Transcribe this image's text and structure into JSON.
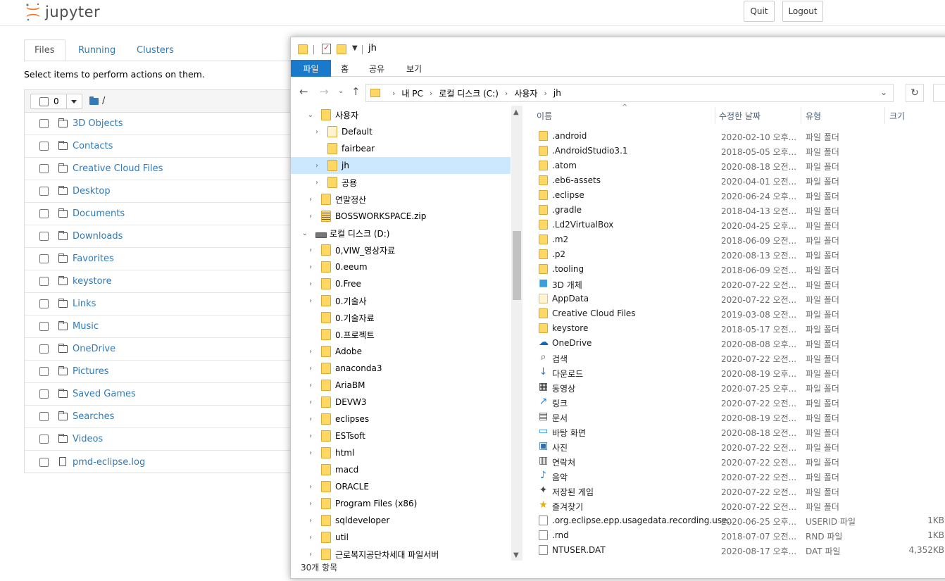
{
  "jupyter": {
    "brand": "jupyter",
    "quit_label": "Quit",
    "logout_label": "Logout",
    "tabs": [
      "Files",
      "Running",
      "Clusters"
    ],
    "hint": "Select items to perform actions on them.",
    "selected_count": "0",
    "path": "/",
    "items": [
      {
        "name": "3D Objects",
        "kind": "folder"
      },
      {
        "name": "Contacts",
        "kind": "folder"
      },
      {
        "name": "Creative Cloud Files",
        "kind": "folder"
      },
      {
        "name": "Desktop",
        "kind": "folder"
      },
      {
        "name": "Documents",
        "kind": "folder"
      },
      {
        "name": "Downloads",
        "kind": "folder"
      },
      {
        "name": "Favorites",
        "kind": "folder"
      },
      {
        "name": "keystore",
        "kind": "folder"
      },
      {
        "name": "Links",
        "kind": "folder"
      },
      {
        "name": "Music",
        "kind": "folder"
      },
      {
        "name": "OneDrive",
        "kind": "folder"
      },
      {
        "name": "Pictures",
        "kind": "folder"
      },
      {
        "name": "Saved Games",
        "kind": "folder"
      },
      {
        "name": "Searches",
        "kind": "folder"
      },
      {
        "name": "Videos",
        "kind": "folder"
      },
      {
        "name": "pmd-eclipse.log",
        "kind": "file"
      }
    ]
  },
  "explorer": {
    "title": "jh",
    "ribbon": {
      "file": "파일",
      "home": "홈",
      "share": "공유",
      "view": "보기"
    },
    "address": [
      "내 PC",
      "로컬 디스크 (C:)",
      "사용자",
      "jh"
    ],
    "columns": {
      "name": "이름",
      "date": "수정한 날짜",
      "type": "유형",
      "size": "크기"
    },
    "tree": [
      {
        "label": "사용자",
        "expander": "open",
        "level": 0,
        "icon": "folder"
      },
      {
        "label": "Default",
        "expander": "closed",
        "level": 1,
        "icon": "pale"
      },
      {
        "label": "fairbear",
        "expander": "none",
        "level": 1,
        "icon": "folder"
      },
      {
        "label": "jh",
        "expander": "closed",
        "level": 1,
        "icon": "folder",
        "selected": true
      },
      {
        "label": "공용",
        "expander": "closed",
        "level": 1,
        "icon": "folder"
      },
      {
        "label": "연말정산",
        "expander": "closed",
        "level": 0,
        "icon": "folder"
      },
      {
        "label": "BOSSWORKSPACE.zip",
        "expander": "closed",
        "level": 0,
        "icon": "zip"
      },
      {
        "label": "로컬 디스크 (D:)",
        "expander": "open",
        "level": -1,
        "icon": "drive"
      },
      {
        "label": "0,VIW_영상자료",
        "expander": "closed",
        "level": 0,
        "icon": "folder"
      },
      {
        "label": "0.eeum",
        "expander": "closed",
        "level": 0,
        "icon": "folder"
      },
      {
        "label": "0.Free",
        "expander": "closed",
        "level": 0,
        "icon": "folder"
      },
      {
        "label": "0.기술사",
        "expander": "closed",
        "level": 0,
        "icon": "folder"
      },
      {
        "label": "0.기술자료",
        "expander": "none",
        "level": 0,
        "icon": "folder"
      },
      {
        "label": "0.프로젝트",
        "expander": "none",
        "level": 0,
        "icon": "folder"
      },
      {
        "label": "Adobe",
        "expander": "closed",
        "level": 0,
        "icon": "folder"
      },
      {
        "label": "anaconda3",
        "expander": "closed",
        "level": 0,
        "icon": "folder"
      },
      {
        "label": "AriaBM",
        "expander": "closed",
        "level": 0,
        "icon": "folder"
      },
      {
        "label": "DEVW3",
        "expander": "closed",
        "level": 0,
        "icon": "folder"
      },
      {
        "label": "eclipses",
        "expander": "closed",
        "level": 0,
        "icon": "folder"
      },
      {
        "label": "ESTsoft",
        "expander": "closed",
        "level": 0,
        "icon": "folder"
      },
      {
        "label": "html",
        "expander": "closed",
        "level": 0,
        "icon": "folder"
      },
      {
        "label": "macd",
        "expander": "none",
        "level": 0,
        "icon": "folder"
      },
      {
        "label": "ORACLE",
        "expander": "closed",
        "level": 0,
        "icon": "folder"
      },
      {
        "label": "Program Files (x86)",
        "expander": "closed",
        "level": 0,
        "icon": "folder"
      },
      {
        "label": "sqldeveloper",
        "expander": "closed",
        "level": 0,
        "icon": "folder"
      },
      {
        "label": "util",
        "expander": "closed",
        "level": 0,
        "icon": "folder"
      },
      {
        "label": "근로복지공단차세대 파일서버",
        "expander": "closed",
        "level": 0,
        "icon": "folder"
      }
    ],
    "files": [
      {
        "name": ".android",
        "date": "2020-02-10 오후...",
        "type": "파일 폴더",
        "size": "",
        "icon": "folder"
      },
      {
        "name": ".AndroidStudio3.1",
        "date": "2018-05-05 오후...",
        "type": "파일 폴더",
        "size": "",
        "icon": "folder"
      },
      {
        "name": ".atom",
        "date": "2020-08-18 오전...",
        "type": "파일 폴더",
        "size": "",
        "icon": "folder"
      },
      {
        "name": ".eb6-assets",
        "date": "2020-04-01 오전...",
        "type": "파일 폴더",
        "size": "",
        "icon": "folder"
      },
      {
        "name": ".eclipse",
        "date": "2020-06-24 오후...",
        "type": "파일 폴더",
        "size": "",
        "icon": "folder"
      },
      {
        "name": ".gradle",
        "date": "2018-04-13 오전...",
        "type": "파일 폴더",
        "size": "",
        "icon": "folder"
      },
      {
        "name": ".Ld2VirtualBox",
        "date": "2020-04-25 오후...",
        "type": "파일 폴더",
        "size": "",
        "icon": "folder"
      },
      {
        "name": ".m2",
        "date": "2018-06-09 오전...",
        "type": "파일 폴더",
        "size": "",
        "icon": "folder"
      },
      {
        "name": ".p2",
        "date": "2020-08-13 오전...",
        "type": "파일 폴더",
        "size": "",
        "icon": "folder"
      },
      {
        "name": ".tooling",
        "date": "2018-06-09 오전...",
        "type": "파일 폴더",
        "size": "",
        "icon": "folder"
      },
      {
        "name": "3D 개체",
        "date": "2020-07-22 오전...",
        "type": "파일 폴더",
        "size": "",
        "icon": "cube"
      },
      {
        "name": "AppData",
        "date": "2020-07-22 오전...",
        "type": "파일 폴더",
        "size": "",
        "icon": "pale"
      },
      {
        "name": "Creative Cloud Files",
        "date": "2019-03-08 오전...",
        "type": "파일 폴더",
        "size": "",
        "icon": "folder"
      },
      {
        "name": "keystore",
        "date": "2018-05-17 오전...",
        "type": "파일 폴더",
        "size": "",
        "icon": "folder"
      },
      {
        "name": "OneDrive",
        "date": "2020-08-08 오후...",
        "type": "파일 폴더",
        "size": "",
        "icon": "cloud"
      },
      {
        "name": "검색",
        "date": "2020-07-22 오전...",
        "type": "파일 폴더",
        "size": "",
        "icon": "search"
      },
      {
        "name": "다운로드",
        "date": "2020-08-19 오후...",
        "type": "파일 폴더",
        "size": "",
        "icon": "download"
      },
      {
        "name": "동영상",
        "date": "2020-07-25 오후...",
        "type": "파일 폴더",
        "size": "",
        "icon": "video"
      },
      {
        "name": "링크",
        "date": "2020-07-22 오전...",
        "type": "파일 폴더",
        "size": "",
        "icon": "link"
      },
      {
        "name": "문서",
        "date": "2020-08-19 오전...",
        "type": "파일 폴더",
        "size": "",
        "icon": "document"
      },
      {
        "name": "바탕 화면",
        "date": "2020-08-18 오전...",
        "type": "파일 폴더",
        "size": "",
        "icon": "desktop"
      },
      {
        "name": "사진",
        "date": "2020-07-22 오전...",
        "type": "파일 폴더",
        "size": "",
        "icon": "picture"
      },
      {
        "name": "연락처",
        "date": "2020-07-22 오전...",
        "type": "파일 폴더",
        "size": "",
        "icon": "contacts"
      },
      {
        "name": "음악",
        "date": "2020-07-22 오전...",
        "type": "파일 폴더",
        "size": "",
        "icon": "music"
      },
      {
        "name": "저장된 게임",
        "date": "2020-07-22 오전...",
        "type": "파일 폴더",
        "size": "",
        "icon": "game"
      },
      {
        "name": "즐겨찾기",
        "date": "2020-07-22 오전...",
        "type": "파일 폴더",
        "size": "",
        "icon": "star"
      },
      {
        "name": ".org.eclipse.epp.usagedata.recording.use...",
        "date": "2020-06-25 오후...",
        "type": "USERID 파일",
        "size": "1KB",
        "icon": "doc"
      },
      {
        "name": ".rnd",
        "date": "2018-07-07 오전...",
        "type": "RND 파일",
        "size": "1KB",
        "icon": "doc"
      },
      {
        "name": "NTUSER.DAT",
        "date": "2020-08-17 오후...",
        "type": "DAT 파일",
        "size": "4,352KB",
        "icon": "doc"
      }
    ],
    "status": "30개 항목"
  }
}
